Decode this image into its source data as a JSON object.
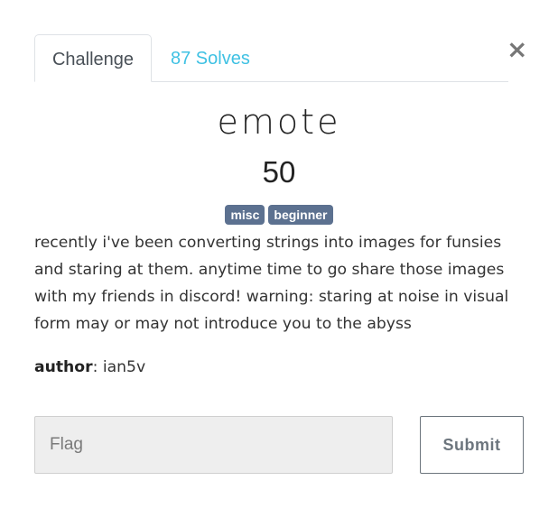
{
  "tabs": {
    "challenge_label": "Challenge",
    "solves_label": "87 Solves"
  },
  "close_glyph": "×",
  "challenge": {
    "name": "emote",
    "points": "50",
    "tags": [
      "misc",
      "beginner"
    ],
    "description": "recently i've been converting strings into images for funsies and staring at them. anytime time to go share those images with my friends in discord! warning: staring at noise in visual form may or may not introduce you to the abyss",
    "author_key": "author",
    "author_sep": ": ",
    "author_value": "ian5v"
  },
  "form": {
    "flag_placeholder": "Flag",
    "flag_value": "",
    "submit_label": "Submit"
  },
  "colors": {
    "accent": "#3fc1e3",
    "tag_bg": "#5c7190",
    "input_bg": "#eeeeee",
    "button_border": "#6c757d"
  }
}
